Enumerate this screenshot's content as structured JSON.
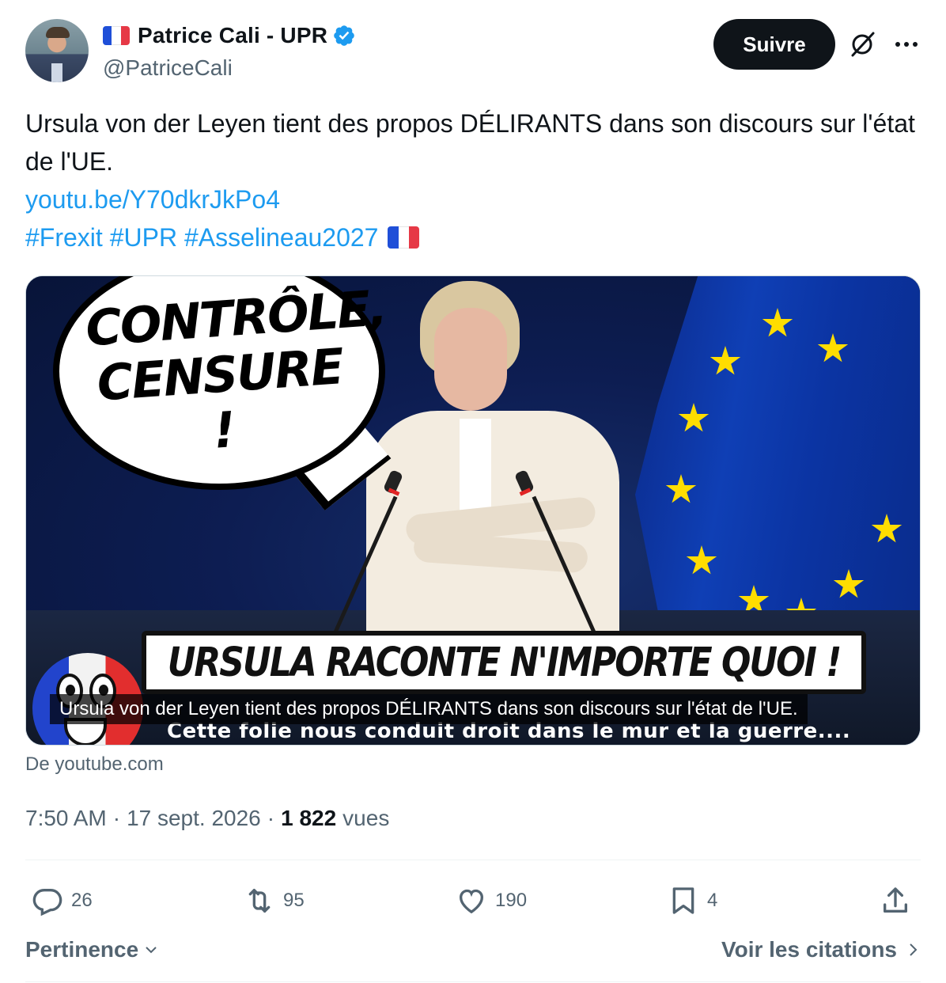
{
  "author": {
    "display_name": "Patrice Cali - UPR",
    "handle": "@PatriceCali",
    "verified": true,
    "flag_emoji": "french-flag"
  },
  "header": {
    "follow_label": "Suivre",
    "grok_icon": "grok-icon",
    "more_icon": "more-icon"
  },
  "tweet": {
    "text": "Ursula von der Leyen tient des propos DÉLIRANTS dans son discours sur l'état de l'UE.",
    "link": "youtu.be/Y70dkrJkPo4",
    "hashtags": "#Frexit #UPR #Asselineau2027"
  },
  "media": {
    "bubble_text_line1": "CONTRÔLE,",
    "bubble_text_line2": "CENSURE !",
    "banner_text": "URSULA RACONTE N'IMPORTE QUOI !",
    "caption": "Ursula von der Leyen tient des propos DÉLIRANTS dans son discours sur l'état de l'UE.",
    "subtitle": "Cette folie nous conduit droit dans le mur et la guerre....",
    "source": "De youtube.com"
  },
  "meta": {
    "time": "7:50 AM",
    "sep1": "·",
    "date": "17 sept. 2026",
    "sep2": "·",
    "views_count": "1 822",
    "views_label": "vues"
  },
  "actions": {
    "replies": "26",
    "reposts": "95",
    "likes": "190",
    "bookmarks": "4"
  },
  "footer": {
    "sort_label": "Pertinence",
    "quotes_label": "Voir les citations"
  },
  "colors": {
    "accent": "#1d9bf0",
    "text": "#0f1419",
    "muted": "#536471",
    "button_bg": "#0f1419"
  }
}
